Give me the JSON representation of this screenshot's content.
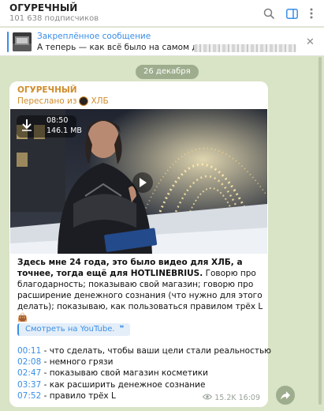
{
  "header": {
    "title": "ОГУРЕЧНЫЙ",
    "subscribers": "101 638 подписчиков",
    "search_icon": "search-icon",
    "sidebar_icon": "sidebar-toggle-icon",
    "menu_icon": "more-vertical-icon"
  },
  "pinned": {
    "title": "Закреплённое сообщение",
    "text": "А теперь — как всё было на самом деле.",
    "close_icon": "close-icon"
  },
  "date_separator": "26 декабря",
  "message": {
    "sender": "ОГУРЕЧНЫЙ",
    "forwarded_prefix": "Переслано из",
    "forwarded_from": "ХЛБ",
    "video": {
      "duration": "08:50",
      "size": "146.1 MB"
    },
    "caption_bold": "Здесь мне 24 года, это было видео для ХЛБ, а точнее, тогда ещё для HOTLINEBRIUS.",
    "caption_rest": " Говорю про благодарность; показываю свой магазин; говорю про расширение денежного сознания (что нужно для этого делать); показываю, как пользоваться правилом трёх L 👜",
    "youtube_link": "Смотреть на YouTube.",
    "youtube_quote": "❞",
    "chapters": [
      {
        "time": "00:11",
        "text": " - что сделать, чтобы ваши цели стали реальностью"
      },
      {
        "time": "02:08",
        "text": " - немного грязи"
      },
      {
        "time": "02:47",
        "text": " - показываю свой магазин косметики"
      },
      {
        "time": "03:37",
        "text": " - как расширить денежное сознание"
      },
      {
        "time": "07:52",
        "text": " - правило трёх L"
      }
    ],
    "views": "15.2K",
    "time": "16:09"
  },
  "colors": {
    "accent": "#3a8ee6",
    "sender": "#d08c2c",
    "background": "#d9e3c5"
  }
}
